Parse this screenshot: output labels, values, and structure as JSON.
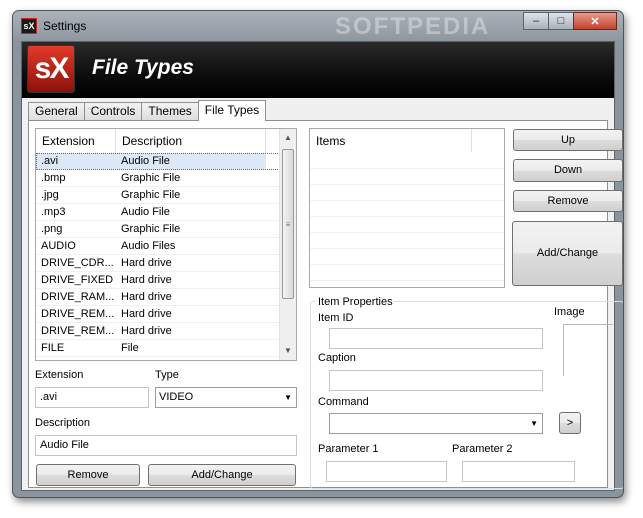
{
  "window": {
    "title": "Settings",
    "app_icon_text": "sX",
    "watermark": "SOFTPEDIA",
    "controls": {
      "minimize": "‒",
      "maximize": "□",
      "close": "✕"
    }
  },
  "banner": {
    "logo_text": "sX",
    "title": "File Types"
  },
  "tabs": [
    {
      "label": "General",
      "active": false
    },
    {
      "label": "Controls",
      "active": false
    },
    {
      "label": "Themes",
      "active": false
    },
    {
      "label": "File Types",
      "active": true
    }
  ],
  "file_list": {
    "columns": [
      "Extension",
      "Description"
    ],
    "rows": [
      {
        "ext": ".avi",
        "desc": "Audio File",
        "selected": true
      },
      {
        "ext": ".bmp",
        "desc": "Graphic File"
      },
      {
        "ext": ".jpg",
        "desc": "Graphic File"
      },
      {
        "ext": ".mp3",
        "desc": "Audio File"
      },
      {
        "ext": ".png",
        "desc": "Graphic File"
      },
      {
        "ext": "AUDIO",
        "desc": "Audio Files"
      },
      {
        "ext": "DRIVE_CDR...",
        "desc": "Hard drive"
      },
      {
        "ext": "DRIVE_FIXED",
        "desc": "Hard drive"
      },
      {
        "ext": "DRIVE_RAM...",
        "desc": "Hard drive"
      },
      {
        "ext": "DRIVE_REM...",
        "desc": "Hard drive"
      },
      {
        "ext": "DRIVE_REM...",
        "desc": "Hard drive"
      },
      {
        "ext": "FILE",
        "desc": "File"
      }
    ]
  },
  "form": {
    "extension_label": "Extension",
    "extension_value": ".avi",
    "type_label": "Type",
    "type_value": "VIDEO",
    "description_label": "Description",
    "description_value": "Audio File",
    "remove_button": "Remove",
    "add_change_button": "Add/Change"
  },
  "items": {
    "header": "Items",
    "up_button": "Up",
    "down_button": "Down",
    "remove_button": "Remove",
    "add_change_button": "Add/Change"
  },
  "item_properties": {
    "group_label": "Item Properties",
    "item_id_label": "Item ID",
    "item_id_value": "",
    "caption_label": "Caption",
    "caption_value": "",
    "command_label": "Command",
    "command_value": "",
    "browse_button": ">",
    "image_label": "Image",
    "parameter1_label": "Parameter 1",
    "parameter1_value": "",
    "parameter2_label": "Parameter 2",
    "parameter2_value": ""
  }
}
